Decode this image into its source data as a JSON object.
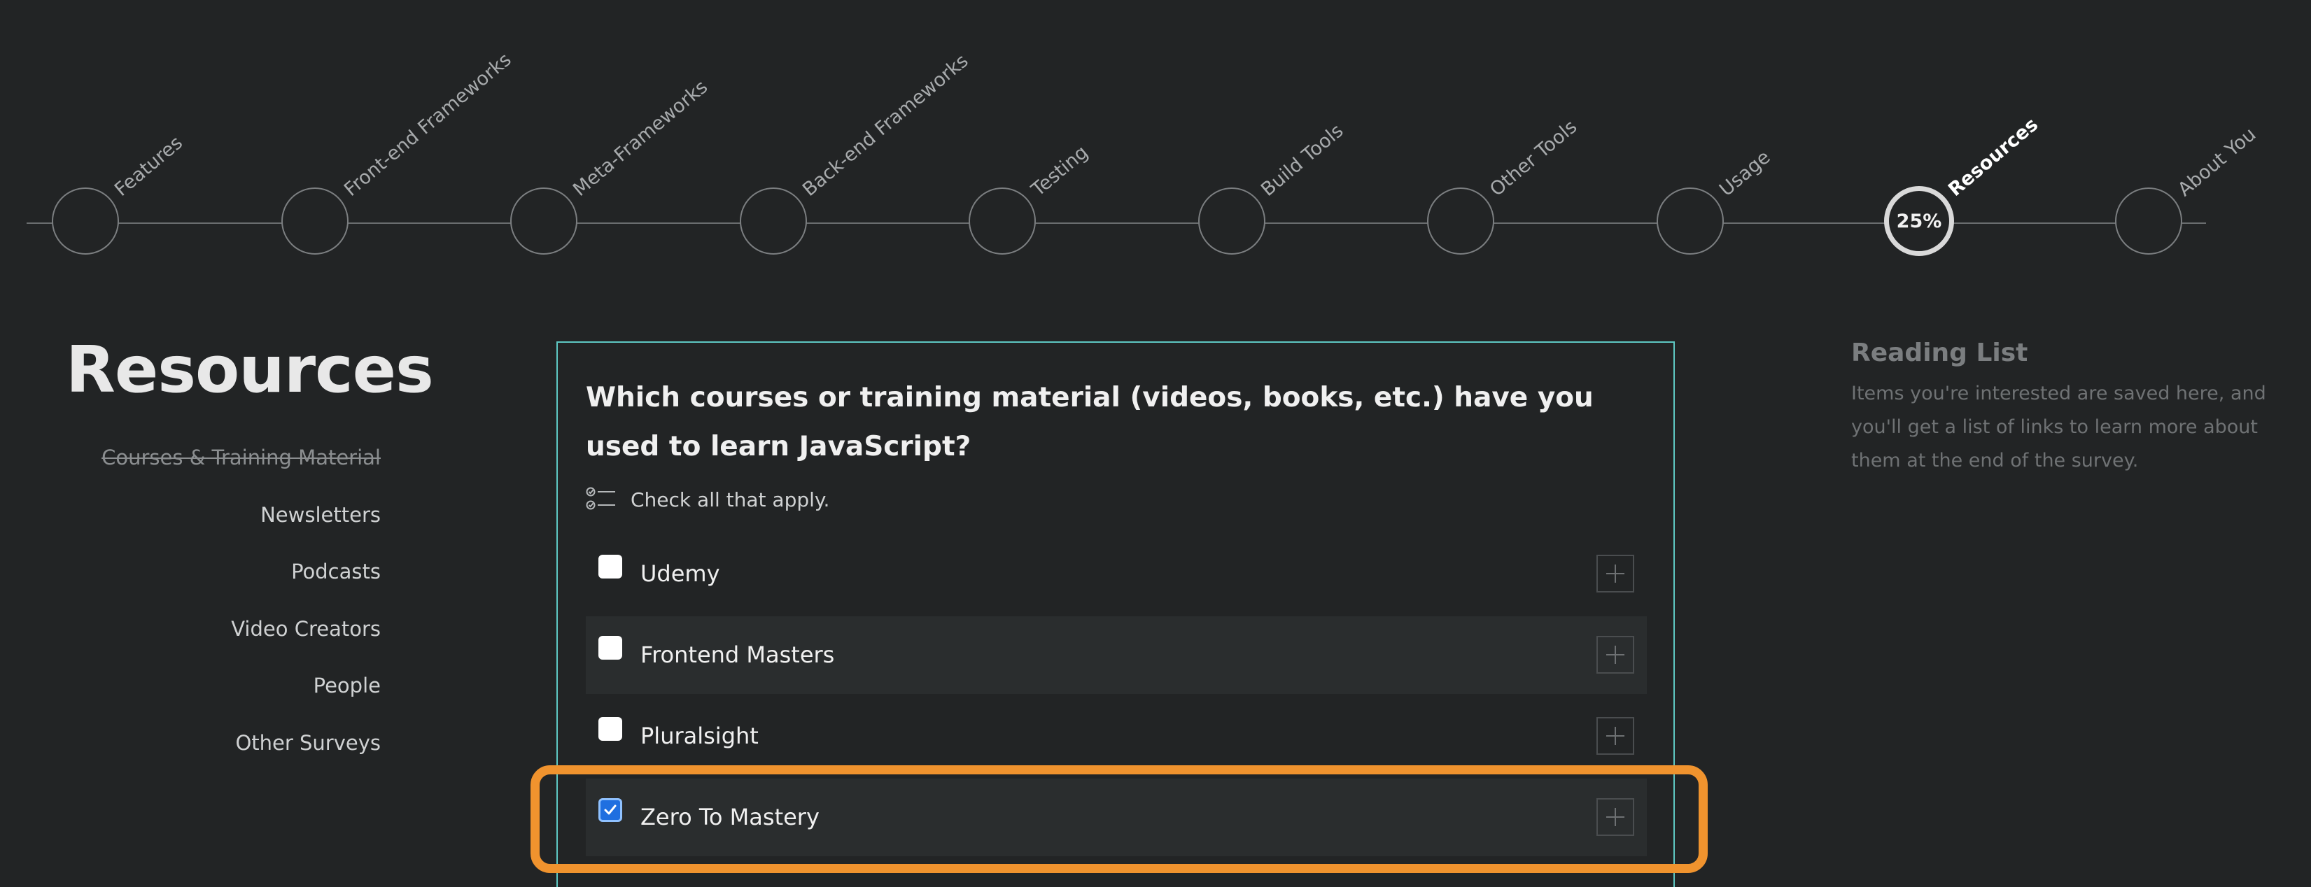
{
  "steps": {
    "items": [
      {
        "label": "Features"
      },
      {
        "label": "Front-end Frameworks"
      },
      {
        "label": "Meta-Frameworks"
      },
      {
        "label": "Back-end Frameworks"
      },
      {
        "label": "Testing"
      },
      {
        "label": "Build Tools"
      },
      {
        "label": "Other Tools"
      },
      {
        "label": "Usage"
      },
      {
        "label": "Resources"
      },
      {
        "label": "About You"
      }
    ],
    "current_index": 8,
    "progress": "25%"
  },
  "section": {
    "title": "Resources",
    "nav": [
      {
        "label": "Courses & Training Material",
        "visited": true
      },
      {
        "label": "Newsletters",
        "visited": false
      },
      {
        "label": "Podcasts",
        "visited": false
      },
      {
        "label": "Video Creators",
        "visited": false
      },
      {
        "label": "People",
        "visited": false
      },
      {
        "label": "Other Surveys",
        "visited": false
      }
    ]
  },
  "question": {
    "title": "Which courses or training material (videos, books, etc.) have you used to learn JavaScript?",
    "hint": "Check all that apply.",
    "hint_icon": "checklist-icon",
    "options": [
      {
        "label": "Udemy",
        "checked": false
      },
      {
        "label": "Frontend Masters",
        "checked": false
      },
      {
        "label": "Pluralsight",
        "checked": false
      },
      {
        "label": "Zero To Mastery",
        "checked": true
      }
    ]
  },
  "reading_list": {
    "title": "Reading List",
    "description": "Items you're interested are saved here, and you'll get a list of links to learn more about them at the end of the survey."
  },
  "colors": {
    "background": "#222425",
    "card_border": "#5ec8c3",
    "highlight": "#f0932e",
    "checkbox_checked": "#1f6fe0"
  }
}
